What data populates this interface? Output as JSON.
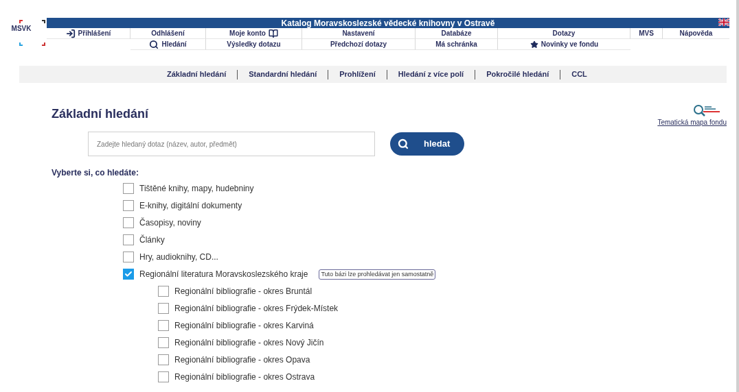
{
  "logo": {
    "text": "MSVK"
  },
  "header": {
    "title": "Katalog Moravskoslezské vědecké knihovny v Ostravě"
  },
  "menu_row_1": [
    {
      "label": "Přihlášení",
      "kind": "login"
    },
    {
      "label": "Odhlášení"
    },
    {
      "label": "Moje konto",
      "kind": "books"
    },
    {
      "label": "Nastavení"
    },
    {
      "label": "Databáze"
    },
    {
      "label": "Dotazy"
    },
    {
      "label": "MVS"
    },
    {
      "label": "Nápověda"
    }
  ],
  "menu_row_2": [
    {
      "label": "Hledání",
      "kind": "search"
    },
    {
      "label": "Výsledky dotazu"
    },
    {
      "label": "Předchozí dotazy"
    },
    {
      "label": "Má schránka"
    },
    {
      "label": "Novinky ve fondu",
      "kind": "star"
    }
  ],
  "search_tabs": [
    "Základní hledání",
    "Standardní hledání",
    "Prohlížení",
    "Hledání z více polí",
    "Pokročilé hledání",
    "CCL"
  ],
  "page_title": "Základní hledání",
  "side_link": "Tematická mapa fondu",
  "search": {
    "placeholder": "Zadejte hledaný dotaz (název, autor, předmět)",
    "button": "hledat"
  },
  "choose_label": "Vyberte si, co hledáte:",
  "categories": [
    {
      "label": "Tištěné knihy, mapy, hudebniny",
      "checked": false
    },
    {
      "label": "E-knihy, digitální dokumenty",
      "checked": false
    },
    {
      "label": "Časopisy, noviny",
      "checked": false
    },
    {
      "label": "Články",
      "checked": false
    },
    {
      "label": "Hry, audioknihy, CD...",
      "checked": false
    },
    {
      "label": "Regionální literatura Moravskoslezského kraje",
      "checked": true,
      "note": "Tuto bázi lze prohledávat jen samostatně",
      "children": [
        {
          "label": "Regionální bibliografie - okres Bruntál",
          "checked": false
        },
        {
          "label": "Regionální bibliografie - okres Frýdek-Místek",
          "checked": false
        },
        {
          "label": "Regionální bibliografie - okres Karviná",
          "checked": false
        },
        {
          "label": "Regionální bibliografie - okres Nový Jičín",
          "checked": false
        },
        {
          "label": "Regionální bibliografie - okres Opava",
          "checked": false
        },
        {
          "label": "Regionální bibliografie - okres Ostrava",
          "checked": false
        }
      ]
    }
  ]
}
